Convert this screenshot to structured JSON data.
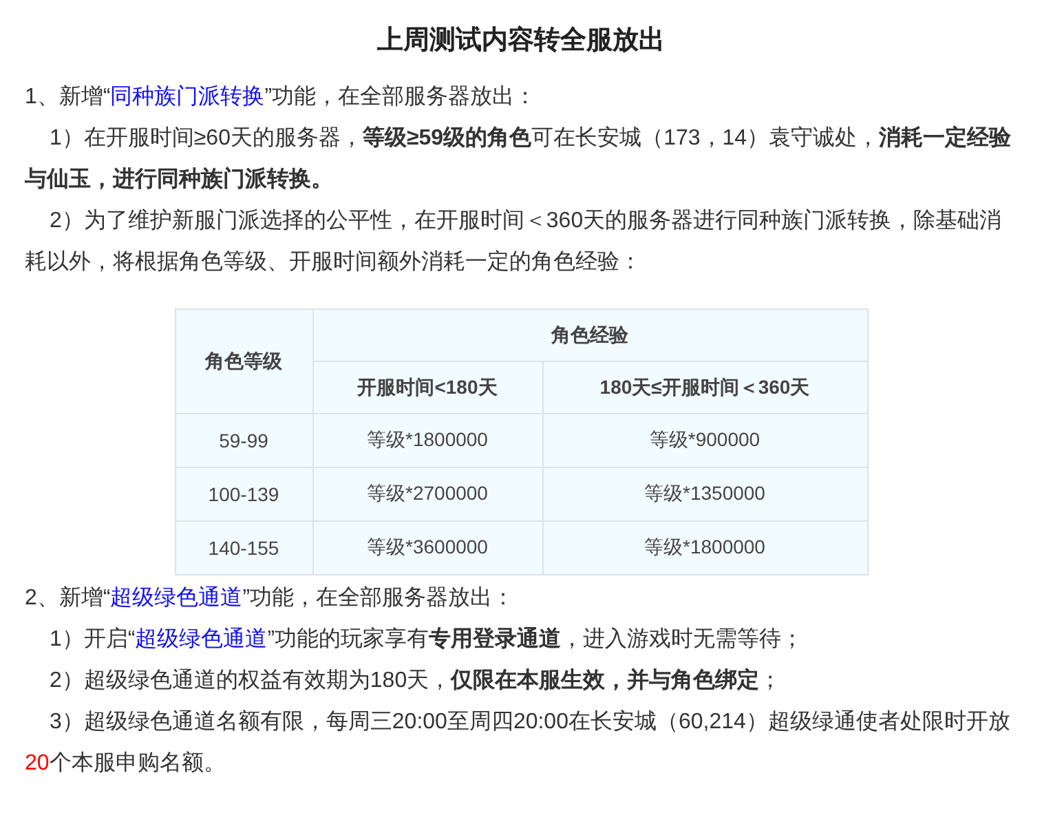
{
  "title": "上周测试内容转全服放出",
  "blocks": [
    {
      "kind": "para",
      "indent": false,
      "segments": [
        {
          "kind": "plain",
          "text": "1、新增“"
        },
        {
          "kind": "link",
          "text": "同种族门派转换"
        },
        {
          "kind": "plain",
          "text": "”功能，在全部服务器放出："
        }
      ]
    },
    {
      "kind": "para",
      "indent": true,
      "segments": [
        {
          "kind": "plain",
          "text": "1）在开服时间≥60天的服务器，"
        },
        {
          "kind": "bold",
          "text": "等级≥59级的角色"
        },
        {
          "kind": "plain",
          "text": "可在长安城（173，14）袁守诚处，"
        },
        {
          "kind": "bold",
          "text": "消耗一定经验与仙玉，进行同种族门派转换。"
        }
      ]
    },
    {
      "kind": "para",
      "indent": true,
      "segments": [
        {
          "kind": "plain",
          "text": "2）为了维护新服门派选择的公平性，在开服时间＜360天的服务器进行同种族门派转换，除基础消耗以外，将根据角色等级、开服时间额外消耗一定的角色经验："
        }
      ]
    },
    {
      "kind": "table",
      "header_rows": [
        [
          {
            "text": "角色等级",
            "kind": "tall"
          },
          {
            "text": "角色经验",
            "kind": "wide"
          }
        ],
        [
          {
            "text": "开服时间<180天",
            "kind": "single"
          },
          {
            "text": "180天≤开服时间＜360天",
            "kind": "single"
          }
        ]
      ],
      "rows": [
        [
          "59-99",
          "等级*1800000",
          "等级*900000"
        ],
        [
          "100-139",
          "等级*2700000",
          "等级*1350000"
        ],
        [
          "140-155",
          "等级*3600000",
          "等级*1800000"
        ]
      ]
    },
    {
      "kind": "para",
      "indent": false,
      "segments": [
        {
          "kind": "plain",
          "text": "2、新增“"
        },
        {
          "kind": "link",
          "text": "超级绿色通道"
        },
        {
          "kind": "plain",
          "text": "”功能，在全部服务器放出："
        }
      ]
    },
    {
      "kind": "para",
      "indent": true,
      "segments": [
        {
          "kind": "plain",
          "text": "1）开启“"
        },
        {
          "kind": "link",
          "text": "超级绿色通道"
        },
        {
          "kind": "plain",
          "text": "”功能的玩家享有"
        },
        {
          "kind": "bold",
          "text": "专用登录通道"
        },
        {
          "kind": "plain",
          "text": "，进入游戏时无需等待；"
        }
      ]
    },
    {
      "kind": "para",
      "indent": true,
      "segments": [
        {
          "kind": "plain",
          "text": "2）超级绿色通道的权益有效期为180天，"
        },
        {
          "kind": "bold",
          "text": "仅限在本服生效，并与角色绑定"
        },
        {
          "kind": "plain",
          "text": "；"
        }
      ]
    },
    {
      "kind": "para",
      "indent": true,
      "segments": [
        {
          "kind": "plain",
          "text": "3）超级绿色通道名额有限，每周三20:00至周四20:00在长安城（60,214）超级绿通使者处限时开放"
        },
        {
          "kind": "red",
          "text": "20"
        },
        {
          "kind": "plain",
          "text": "个本服申购名额。"
        }
      ]
    }
  ]
}
